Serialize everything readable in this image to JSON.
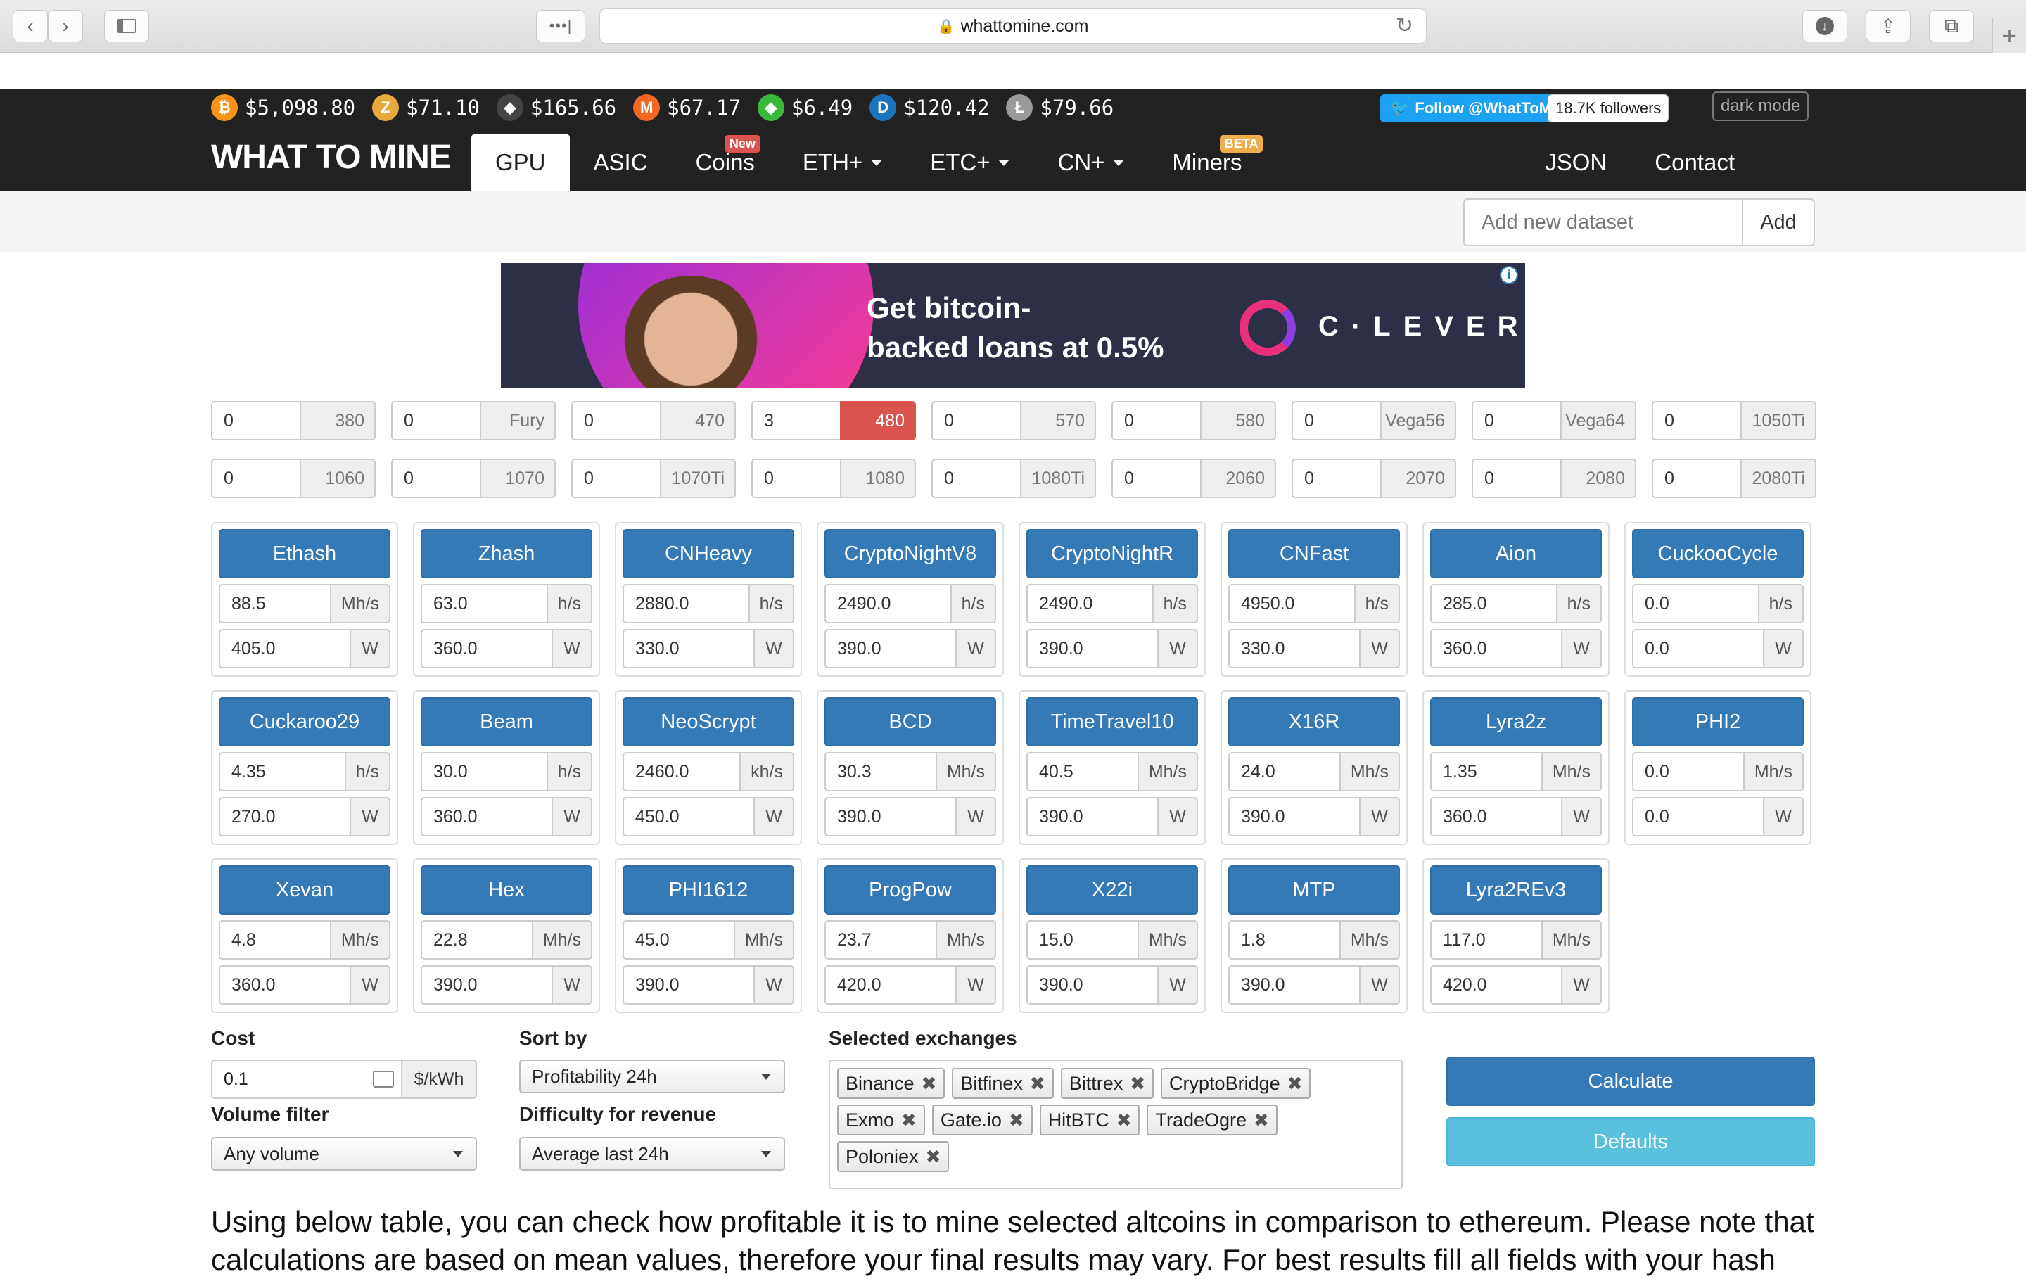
{
  "browser": {
    "url": "whattomine.com"
  },
  "tickers": [
    {
      "icon": "bitcoin-icon",
      "symbol": "₿",
      "color": "#f7931a",
      "price": "$5,098.80"
    },
    {
      "icon": "zcash-icon",
      "symbol": "Z",
      "color": "#e5a93d",
      "price": "$71.10"
    },
    {
      "icon": "ethereum-classic-icon",
      "symbol": "◆",
      "color": "#444444",
      "price": "$165.66"
    },
    {
      "icon": "monero-icon",
      "symbol": "M",
      "color": "#f26822",
      "price": "$67.17"
    },
    {
      "icon": "ethereum-classic-green-icon",
      "symbol": "◆",
      "color": "#3ab83a",
      "price": "$6.49"
    },
    {
      "icon": "dash-icon",
      "symbol": "D",
      "color": "#1c75bc",
      "price": "$120.42"
    },
    {
      "icon": "litecoin-icon",
      "symbol": "Ł",
      "color": "#9a9a9a",
      "price": "$79.66"
    }
  ],
  "social": {
    "follow": "Follow @WhatToMine",
    "followers": "18.7K followers",
    "dark_mode": "dark mode"
  },
  "brand": "WHAT TO MINE",
  "nav": {
    "tabs": [
      {
        "label": "GPU",
        "active": true
      },
      {
        "label": "ASIC"
      },
      {
        "label": "Coins",
        "badge": "New"
      },
      {
        "label": "ETH+",
        "dropdown": true
      },
      {
        "label": "ETC+",
        "dropdown": true
      },
      {
        "label": "CN+",
        "dropdown": true
      },
      {
        "label": "Miners",
        "badge": "BETA"
      }
    ],
    "right": [
      "JSON",
      "Contact"
    ]
  },
  "dataset": {
    "placeholder": "Add new dataset",
    "add": "Add"
  },
  "ad": {
    "headline_1": "Get bitcoin-",
    "headline_2": "backed loans at 0.5%",
    "logo": "C·LEVER"
  },
  "gpus": [
    [
      {
        "count": "0",
        "model": "380"
      },
      {
        "count": "0",
        "model": "Fury"
      },
      {
        "count": "0",
        "model": "470"
      },
      {
        "count": "3",
        "model": "480",
        "selected": true
      },
      {
        "count": "0",
        "model": "570"
      },
      {
        "count": "0",
        "model": "580"
      },
      {
        "count": "0",
        "model": "Vega56"
      },
      {
        "count": "0",
        "model": "Vega64"
      },
      {
        "count": "0",
        "model": "1050Ti"
      }
    ],
    [
      {
        "count": "0",
        "model": "1060"
      },
      {
        "count": "0",
        "model": "1070"
      },
      {
        "count": "0",
        "model": "1070Ti"
      },
      {
        "count": "0",
        "model": "1080"
      },
      {
        "count": "0",
        "model": "1080Ti"
      },
      {
        "count": "0",
        "model": "2060"
      },
      {
        "count": "0",
        "model": "2070"
      },
      {
        "count": "0",
        "model": "2080"
      },
      {
        "count": "0",
        "model": "2080Ti"
      }
    ]
  ],
  "algorithms": [
    {
      "name": "Ethash",
      "hashrate": "88.5",
      "unit": "Mh/s",
      "power": "405.0",
      "power_unit": "W"
    },
    {
      "name": "Zhash",
      "hashrate": "63.0",
      "unit": "h/s",
      "power": "360.0",
      "power_unit": "W"
    },
    {
      "name": "CNHeavy",
      "hashrate": "2880.0",
      "unit": "h/s",
      "power": "330.0",
      "power_unit": "W"
    },
    {
      "name": "CryptoNightV8",
      "hashrate": "2490.0",
      "unit": "h/s",
      "power": "390.0",
      "power_unit": "W"
    },
    {
      "name": "CryptoNightR",
      "hashrate": "2490.0",
      "unit": "h/s",
      "power": "390.0",
      "power_unit": "W"
    },
    {
      "name": "CNFast",
      "hashrate": "4950.0",
      "unit": "h/s",
      "power": "330.0",
      "power_unit": "W"
    },
    {
      "name": "Aion",
      "hashrate": "285.0",
      "unit": "h/s",
      "power": "360.0",
      "power_unit": "W"
    },
    {
      "name": "CuckooCycle",
      "hashrate": "0.0",
      "unit": "h/s",
      "power": "0.0",
      "power_unit": "W"
    },
    {
      "name": "Cuckaroo29",
      "hashrate": "4.35",
      "unit": "h/s",
      "power": "270.0",
      "power_unit": "W"
    },
    {
      "name": "Beam",
      "hashrate": "30.0",
      "unit": "h/s",
      "power": "360.0",
      "power_unit": "W"
    },
    {
      "name": "NeoScrypt",
      "hashrate": "2460.0",
      "unit": "kh/s",
      "power": "450.0",
      "power_unit": "W"
    },
    {
      "name": "BCD",
      "hashrate": "30.3",
      "unit": "Mh/s",
      "power": "390.0",
      "power_unit": "W"
    },
    {
      "name": "TimeTravel10",
      "hashrate": "40.5",
      "unit": "Mh/s",
      "power": "390.0",
      "power_unit": "W"
    },
    {
      "name": "X16R",
      "hashrate": "24.0",
      "unit": "Mh/s",
      "power": "390.0",
      "power_unit": "W"
    },
    {
      "name": "Lyra2z",
      "hashrate": "1.35",
      "unit": "Mh/s",
      "power": "360.0",
      "power_unit": "W"
    },
    {
      "name": "PHI2",
      "hashrate": "0.0",
      "unit": "Mh/s",
      "power": "0.0",
      "power_unit": "W"
    },
    {
      "name": "Xevan",
      "hashrate": "4.8",
      "unit": "Mh/s",
      "power": "360.0",
      "power_unit": "W"
    },
    {
      "name": "Hex",
      "hashrate": "22.8",
      "unit": "Mh/s",
      "power": "390.0",
      "power_unit": "W"
    },
    {
      "name": "PHI1612",
      "hashrate": "45.0",
      "unit": "Mh/s",
      "power": "390.0",
      "power_unit": "W"
    },
    {
      "name": "ProgPow",
      "hashrate": "23.7",
      "unit": "Mh/s",
      "power": "420.0",
      "power_unit": "W"
    },
    {
      "name": "X22i",
      "hashrate": "15.0",
      "unit": "Mh/s",
      "power": "390.0",
      "power_unit": "W"
    },
    {
      "name": "MTP",
      "hashrate": "1.8",
      "unit": "Mh/s",
      "power": "390.0",
      "power_unit": "W"
    },
    {
      "name": "Lyra2REv3",
      "hashrate": "117.0",
      "unit": "Mh/s",
      "power": "420.0",
      "power_unit": "W"
    }
  ],
  "form": {
    "cost_label": "Cost",
    "cost_value": "0.1",
    "cost_unit": "$/kWh",
    "volume_label": "Volume filter",
    "volume_value": "Any volume",
    "sort_label": "Sort by",
    "sort_value": "Profitability 24h",
    "difficulty_label": "Difficulty for revenue",
    "difficulty_value": "Average last 24h",
    "exchanges_label": "Selected exchanges",
    "exchanges": [
      "Binance",
      "Bitfinex",
      "Bittrex",
      "CryptoBridge",
      "Exmo",
      "Gate.io",
      "HitBTC",
      "TradeOgre",
      "Poloniex"
    ],
    "calculate": "Calculate",
    "defaults": "Defaults"
  },
  "intro": "Using below table, you can check how profitable it is to mine selected altcoins in comparison to ethereum. Please note that calculations are based on mean values, therefore your final results may vary. For best results fill all fields with your hash"
}
